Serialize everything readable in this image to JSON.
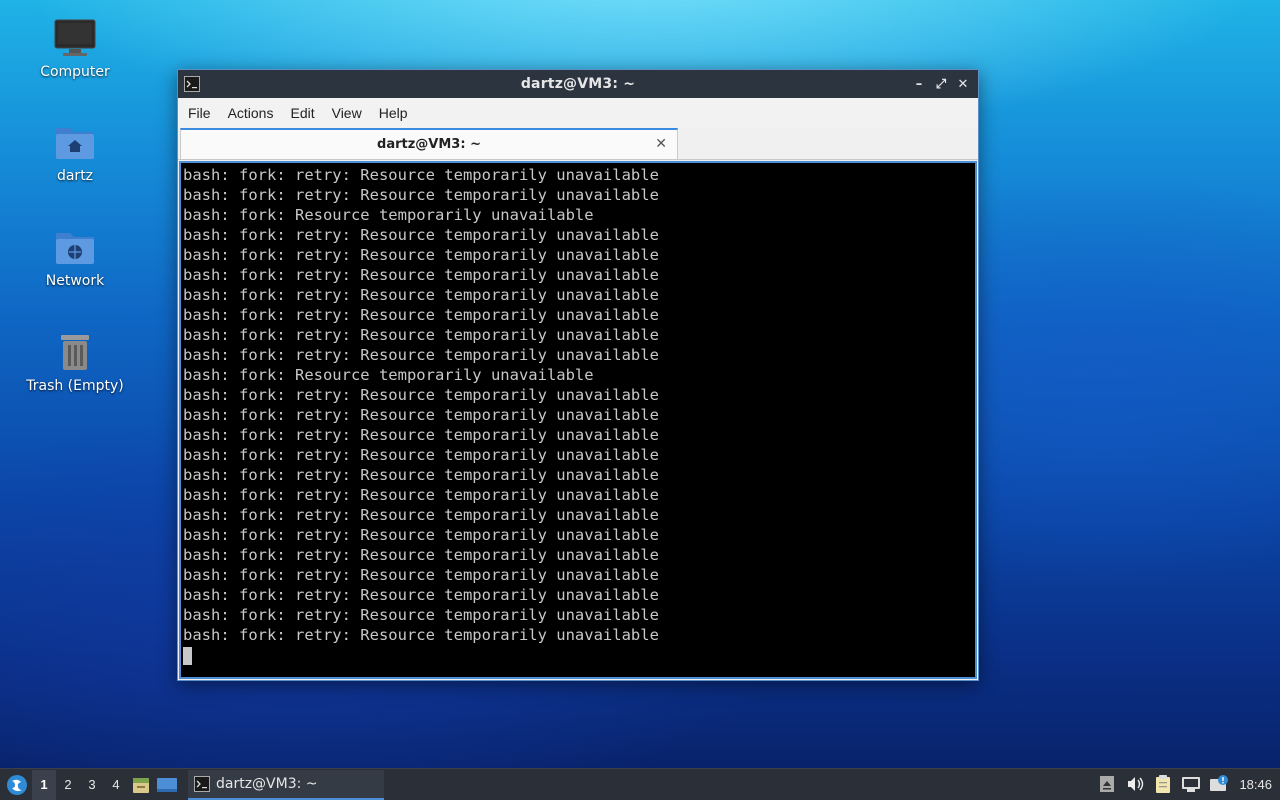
{
  "desktop": {
    "icons": [
      {
        "label": "Computer",
        "icon": "computer-icon"
      },
      {
        "label": "dartz",
        "icon": "home-folder-icon"
      },
      {
        "label": "Network",
        "icon": "network-folder-icon"
      },
      {
        "label": "Trash (Empty)",
        "icon": "trash-icon"
      }
    ]
  },
  "window": {
    "title": "dartz@VM3: ~",
    "controls": {
      "minimize": "–",
      "maximize": "⤢",
      "close": "✕"
    },
    "menu": [
      "File",
      "Actions",
      "Edit",
      "View",
      "Help"
    ],
    "tab": {
      "label": "dartz@VM3: ~",
      "close": "✕"
    },
    "terminal": {
      "lines": [
        "bash: fork: retry: Resource temporarily unavailable",
        "bash: fork: retry: Resource temporarily unavailable",
        "bash: fork: Resource temporarily unavailable",
        "bash: fork: retry: Resource temporarily unavailable",
        "bash: fork: retry: Resource temporarily unavailable",
        "bash: fork: retry: Resource temporarily unavailable",
        "bash: fork: retry: Resource temporarily unavailable",
        "bash: fork: retry: Resource temporarily unavailable",
        "bash: fork: retry: Resource temporarily unavailable",
        "bash: fork: retry: Resource temporarily unavailable",
        "bash: fork: Resource temporarily unavailable",
        "bash: fork: retry: Resource temporarily unavailable",
        "bash: fork: retry: Resource temporarily unavailable",
        "bash: fork: retry: Resource temporarily unavailable",
        "bash: fork: retry: Resource temporarily unavailable",
        "bash: fork: retry: Resource temporarily unavailable",
        "bash: fork: retry: Resource temporarily unavailable",
        "bash: fork: retry: Resource temporarily unavailable",
        "bash: fork: retry: Resource temporarily unavailable",
        "bash: fork: retry: Resource temporarily unavailable",
        "bash: fork: retry: Resource temporarily unavailable",
        "bash: fork: retry: Resource temporarily unavailable",
        "bash: fork: retry: Resource temporarily unavailable",
        "bash: fork: retry: Resource temporarily unavailable"
      ]
    }
  },
  "taskbar": {
    "workspaces": [
      "1",
      "2",
      "3",
      "4"
    ],
    "active_workspace": "1",
    "task": {
      "label": "dartz@VM3: ~",
      "icon": "terminal-icon"
    },
    "clock": "18:46"
  },
  "colors": {
    "accent": "#4d8fd6",
    "titlebar": "#2c3440",
    "terminal_bg": "#000000",
    "terminal_fg": "#c8c8c8",
    "taskbar": "#2b3038"
  }
}
